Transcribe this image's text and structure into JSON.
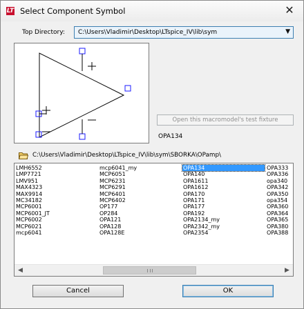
{
  "window": {
    "title": "Select Component Symbol",
    "close_glyph": "✕"
  },
  "top_directory": {
    "label": "Top Directory:",
    "value": "C:\\Users\\Vladimir\\Desktop\\LTspice_IV\\lib\\sym"
  },
  "preview": {
    "plus_input": "+",
    "minus_input": "−",
    "icon": "opamp-symbol-icon"
  },
  "test_fixture_button": "Open this macromodel's test fixture",
  "model_name": "OPA134",
  "current_path": "C:\\Users\\Vladimir\\Desktop\\LTspice_IV\\lib\\sym\\SBORKA\\OPamp\\",
  "list": {
    "columns": [
      [
        "LMH6552",
        "LMP7721",
        "LMV951",
        "MAX4323",
        "MAX9914",
        "MC34182",
        "MCP6001",
        "MCP6001_JT",
        "MCP6002",
        "MCP6021",
        "mcp6041"
      ],
      [
        "mcp6041_my",
        "MCP6051",
        "MCP6231",
        "MCP6291",
        "MCP6401",
        "MCP6402",
        "OP177",
        "OP284",
        "OPA121",
        "OPA128",
        "OPA128E"
      ],
      [
        "OPA134",
        "OPA140",
        "OPA1611",
        "OPA1612",
        "OPA170",
        "OPA171",
        "OPA177",
        "OPA192",
        "OPA2134_my",
        "OPA2342_my",
        "OPA2354"
      ],
      [
        "OPA333",
        "OPA336",
        "opa340",
        "OPA342",
        "OPA350",
        "opa354",
        "OPA360",
        "OPA364",
        "OPA365",
        "OPA380",
        "OPA388"
      ]
    ],
    "selected": "OPA134",
    "selection_color": "#3399ff"
  },
  "buttons": {
    "cancel": "Cancel",
    "ok": "OK"
  },
  "colors": {
    "app_icon": "#c8102e",
    "accent": "#3c7fb1"
  }
}
